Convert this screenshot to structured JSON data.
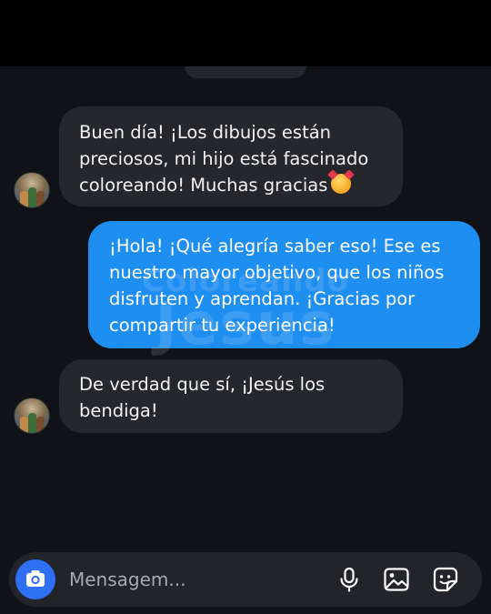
{
  "thread": {
    "messages": [
      {
        "direction": "incoming",
        "lines": [
          "Buen día! ¡Los dibujos están",
          "preciosos, mi hijo está fascinado",
          "coloreando! Muchas gracias"
        ],
        "emoji": "smiling-face-with-hearts"
      },
      {
        "direction": "outgoing",
        "lines": [
          "¡Hola! ¡Qué alegría saber eso! Ese es",
          "nuestro mayor objetivo, que los niños",
          "disfruten y aprendan. ¡Gracias por",
          "compartir tu experiencia!"
        ]
      },
      {
        "direction": "incoming",
        "lines": [
          "De verdad que sí, ¡Jesús los",
          "bendiga!"
        ]
      }
    ]
  },
  "watermark": {
    "line1": "Coloreando",
    "line2": "Jesus"
  },
  "composer": {
    "placeholder": "Mensagem...",
    "camera_icon": "camera-icon",
    "mic_icon": "microphone-icon",
    "gallery_icon": "image-icon",
    "sticker_icon": "sticker-icon"
  },
  "colors": {
    "incoming_bubble": "#25272d",
    "outgoing_bubble": "#1f8ef1",
    "camera_button": "#2f6ff4",
    "background": "#101217"
  }
}
